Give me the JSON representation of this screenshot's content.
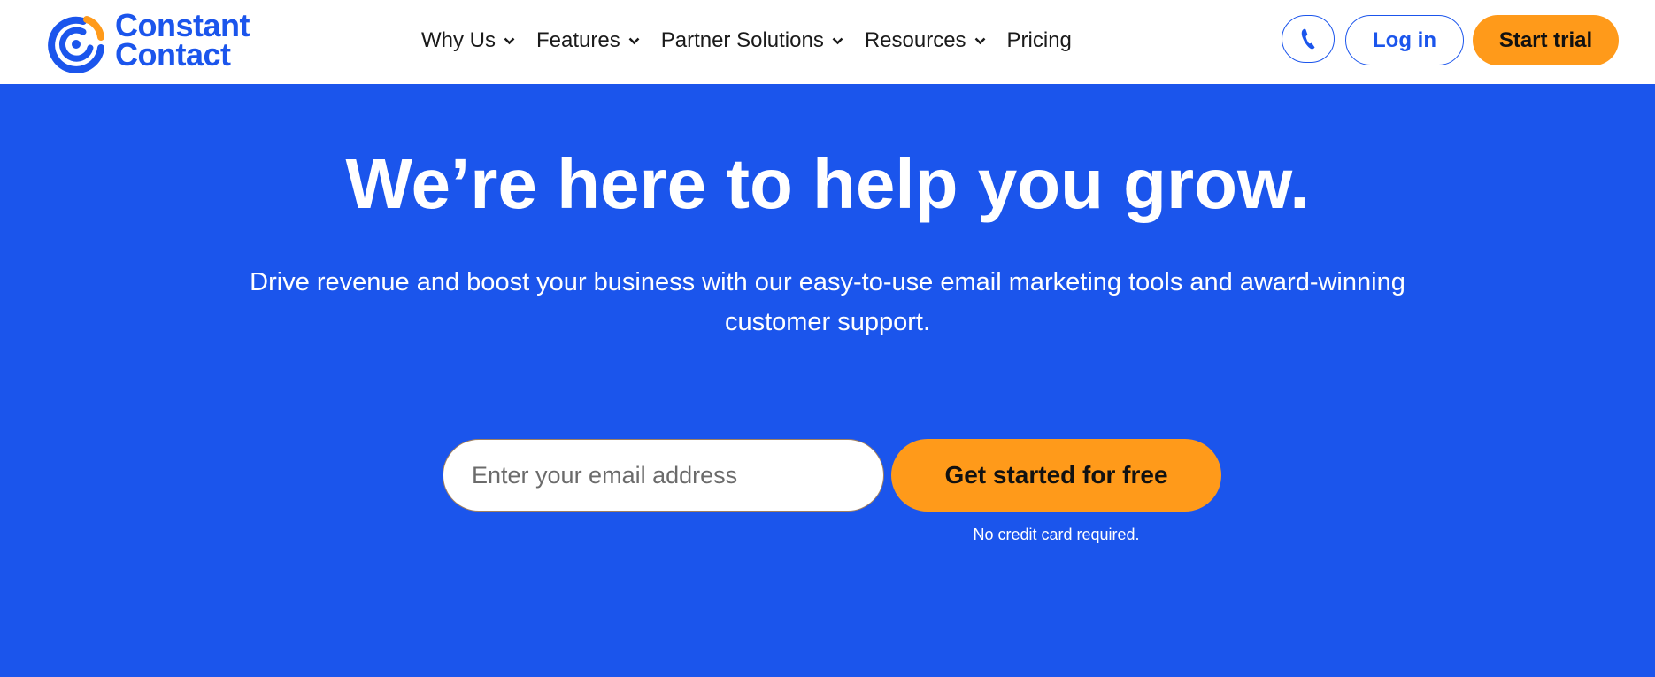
{
  "brand": {
    "line1": "Constant",
    "line2": "Contact"
  },
  "colors": {
    "primary": "#1b55ec",
    "accent": "#ff9a1a",
    "header_bg": "#ffffff"
  },
  "nav": [
    {
      "label": "Why Us",
      "has_dropdown": true
    },
    {
      "label": "Features",
      "has_dropdown": true
    },
    {
      "label": "Partner Solutions",
      "has_dropdown": true
    },
    {
      "label": "Resources",
      "has_dropdown": true
    },
    {
      "label": "Pricing",
      "has_dropdown": false
    }
  ],
  "header_actions": {
    "phone_icon": "phone-icon",
    "login_label": "Log in",
    "trial_label": "Start trial"
  },
  "hero": {
    "headline": "We’re here to help you grow.",
    "subheadline": "Drive revenue and boost your business with our easy-to-use email marketing tools and award-winning customer support.",
    "email_placeholder": "Enter your email address",
    "email_value": "",
    "cta_label": "Get started for free",
    "note": "No credit card required."
  }
}
